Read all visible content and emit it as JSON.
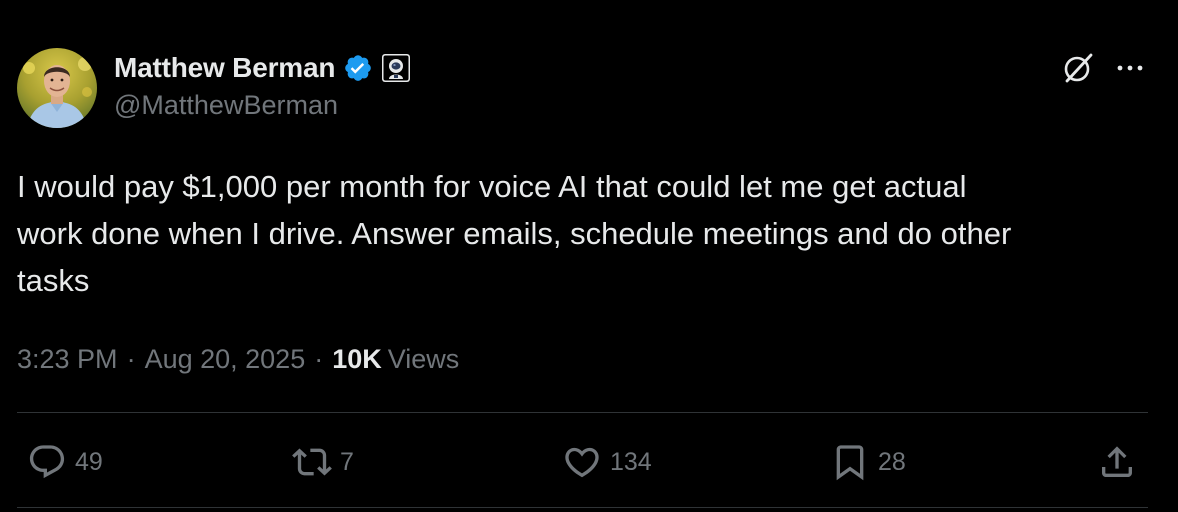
{
  "author": {
    "display_name": "Matthew Berman",
    "handle": "@MatthewBerman",
    "verified_icon": "verified-badge-icon",
    "affiliate_icon": "astronaut-badge-icon"
  },
  "header_actions": {
    "grok_icon": "grok-icon",
    "more_icon": "more-icon"
  },
  "tweet": {
    "text": "I would pay $1,000 per month for voice AI that could let me get actual\nwork done when I drive. Answer emails, schedule meetings and do other\ntasks",
    "time": "3:23 PM",
    "separator": "·",
    "date": "Aug 20, 2025",
    "views_count": "10K",
    "views_label": "Views"
  },
  "actions": {
    "replies": "49",
    "reposts": "7",
    "likes": "134",
    "bookmarks": "28"
  },
  "colors": {
    "background": "#000000",
    "text_primary": "#e7e9ea",
    "text_secondary": "#71767b",
    "verified_blue": "#1d9bf0",
    "divider": "#2f3336"
  }
}
